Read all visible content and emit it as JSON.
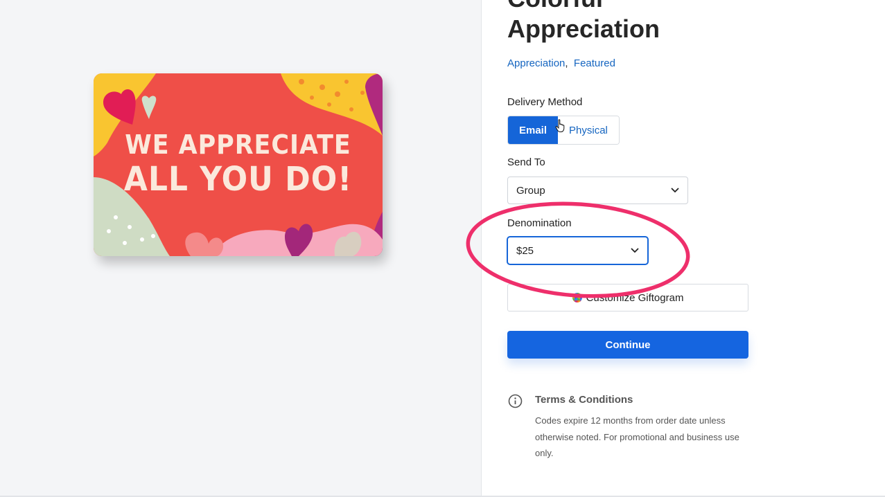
{
  "product": {
    "title_line1": "Colorful",
    "title_line2": "Appreciation",
    "tags": [
      "Appreciation",
      "Featured"
    ],
    "tag_separator": ","
  },
  "card": {
    "line1": "WE APPRECIATE",
    "line2": "ALL YOU DO!",
    "colors": {
      "background": "#ef4f48",
      "yellow": "#f9c530",
      "purple": "#b02a7e",
      "pink": "#f7a9bd",
      "sage": "#cfdcc4"
    }
  },
  "delivery": {
    "label": "Delivery Method",
    "options": [
      "Email",
      "Physical"
    ],
    "selected": "Email"
  },
  "send_to": {
    "label": "Send To",
    "value": "Group"
  },
  "denomination": {
    "label": "Denomination",
    "value": "$25"
  },
  "customize": {
    "label": "Customize Giftogram"
  },
  "continue": {
    "label": "Continue"
  },
  "terms": {
    "title": "Terms & Conditions",
    "body": "Codes expire 12 months from order date unless otherwise noted. For promotional and business use only."
  },
  "colors": {
    "accent": "#1565d8",
    "link": "#1565c0",
    "annotation": "#ee2f6b"
  },
  "icons": [
    "chevron-down-icon",
    "info-icon",
    "hand-pointer-cursor-icon",
    "giftogram-logo-icon"
  ]
}
